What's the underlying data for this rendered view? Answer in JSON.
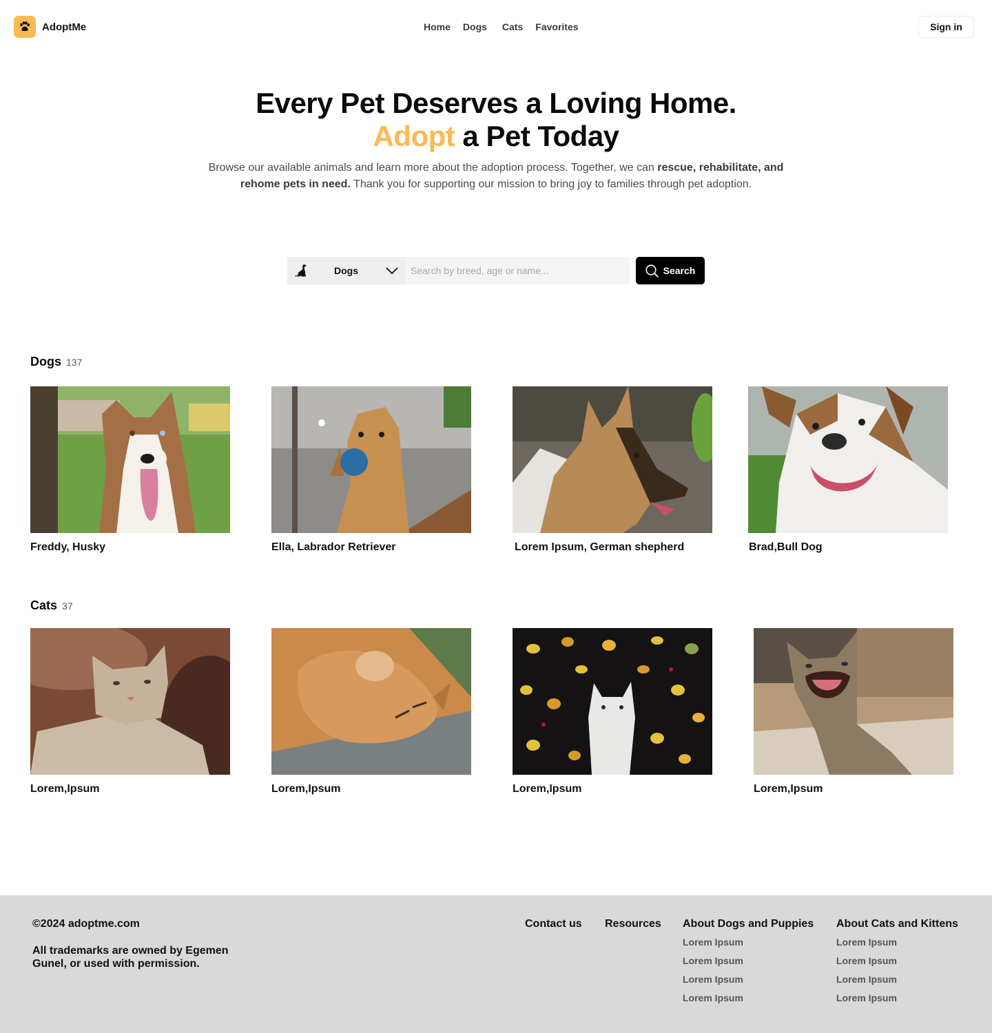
{
  "brand": {
    "name": "AdoptMe",
    "accent_color": "#fdb953",
    "icon": "paw-icon"
  },
  "nav": {
    "items": [
      "Home",
      "Dogs",
      "Cats",
      "Favorites"
    ]
  },
  "header": {
    "signin_label": "Sign in"
  },
  "hero": {
    "title_line1": "Every Pet Deserves a Loving Home.",
    "title_accent": "Adopt",
    "title_rest": " a Pet Today",
    "desc_part1": "Browse our available animals and learn more about the adoption process. Together, we can ",
    "desc_bold": "rescue, rehabilitate, and rehome pets in need.",
    "desc_part2": " Thank you for supporting our mission to bring joy to families through pet adoption."
  },
  "search": {
    "species_selected": "Dogs",
    "species_icon": "dog-silhouette-icon",
    "placeholder": "Search by breed, age or name...",
    "button_label": "Search"
  },
  "dogs": {
    "title": "Dogs",
    "count": "137",
    "items": [
      {
        "caption": "Freddy, Husky"
      },
      {
        "caption": "Ella, Labrador Retriever"
      },
      {
        "caption": "Lorem Ipsum, German shepherd"
      },
      {
        "caption": "Brad,Bull Dog"
      }
    ]
  },
  "cats": {
    "title": "Cats",
    "count": "37",
    "items": [
      {
        "caption": "Lorem,Ipsum"
      },
      {
        "caption": "Lorem,Ipsum"
      },
      {
        "caption": "Lorem,Ipsum"
      },
      {
        "caption": "Lorem,Ipsum"
      }
    ]
  },
  "footer": {
    "copyright": "©2024 adoptme.com",
    "trademark": "All trademarks are owned by Egemen Gunel, or used with permission.",
    "contact": "Contact us",
    "resources": "Resources",
    "col_dogs": {
      "heading": "About Dogs and Puppies",
      "links": [
        "Lorem Ipsum",
        "Lorem Ipsum",
        "Lorem Ipsum",
        "Lorem Ipsum"
      ]
    },
    "col_cats": {
      "heading": "About Cats and Kittens",
      "links": [
        "Lorem Ipsum",
        "Lorem Ipsum",
        "Lorem Ipsum",
        "Lorem Ipsum"
      ]
    }
  }
}
